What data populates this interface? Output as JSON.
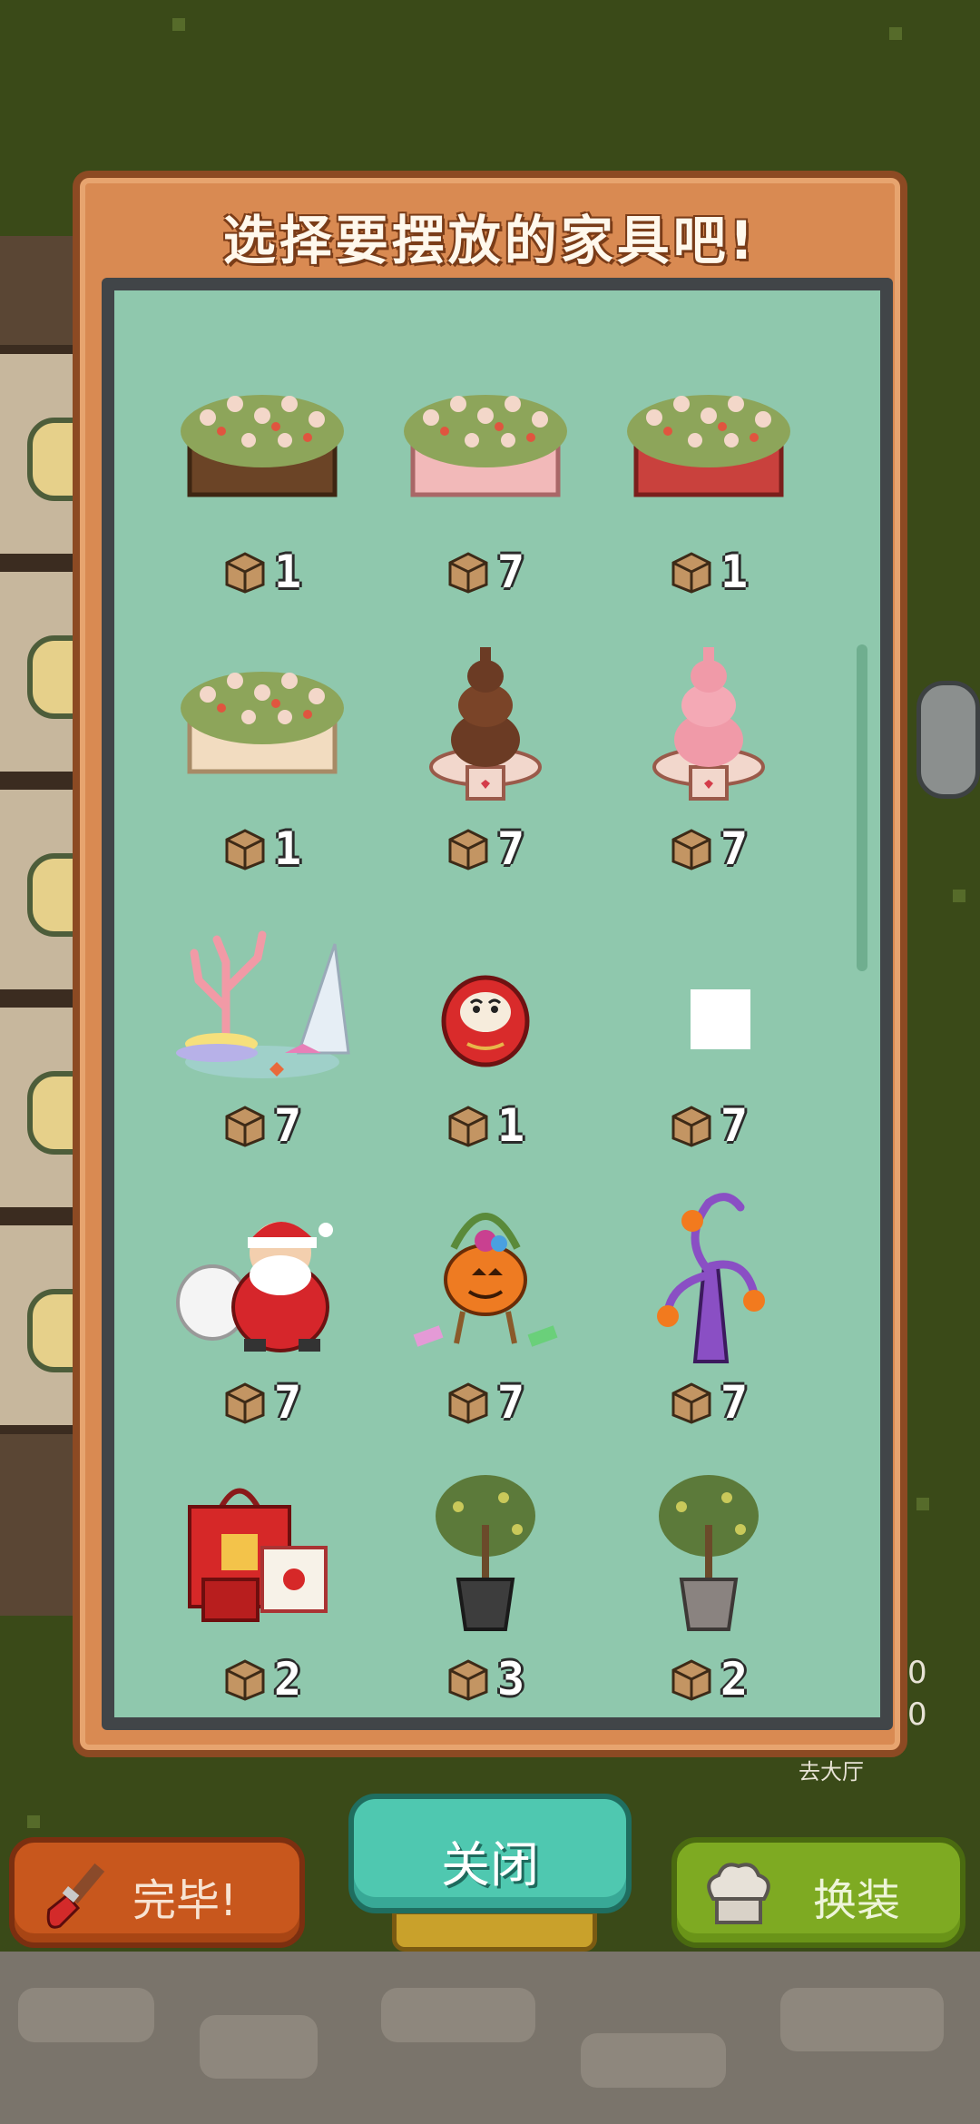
{
  "modal": {
    "title": "选择要摆放的家具吧!"
  },
  "items": [
    {
      "name": "brown-flower-planter",
      "cost": "1"
    },
    {
      "name": "pink-flower-planter",
      "cost": "7"
    },
    {
      "name": "red-flower-planter",
      "cost": "1"
    },
    {
      "name": "cream-flower-planter",
      "cost": "1"
    },
    {
      "name": "chocolate-fountain",
      "cost": "7"
    },
    {
      "name": "strawberry-fountain",
      "cost": "7"
    },
    {
      "name": "coral-shell-decor",
      "cost": "7"
    },
    {
      "name": "daruma-doll",
      "cost": "1"
    },
    {
      "name": "blank-item",
      "cost": "7"
    },
    {
      "name": "santa-claus",
      "cost": "7"
    },
    {
      "name": "pumpkin-candy-basket",
      "cost": "7"
    },
    {
      "name": "halloween-tree",
      "cost": "7"
    },
    {
      "name": "lucky-gift-bags",
      "cost": "2"
    },
    {
      "name": "potted-olive-tree-dark",
      "cost": "3"
    },
    {
      "name": "potted-olive-tree-grey",
      "cost": "2"
    }
  ],
  "buttons": {
    "finish_label": "完毕!",
    "close_label": "关闭",
    "costume_label": "换装"
  },
  "background": {
    "side_label": "去大厅",
    "side_digits": [
      "0",
      "0"
    ]
  },
  "icons": {
    "cost": "box-icon",
    "finish": "paint-brush-icon",
    "costume": "chef-hat-icon"
  }
}
